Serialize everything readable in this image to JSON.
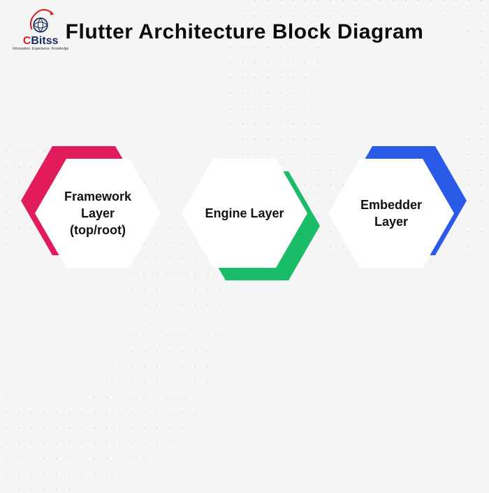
{
  "title": "Flutter Architecture Block Diagram",
  "logo": {
    "brand_prefix": "C",
    "brand_rest": "Bitss",
    "tagline": "Information. Experience. Knowledge"
  },
  "hexagons": [
    {
      "label": "Framework Layer (top/root)",
      "accent_color": "#e21b5a",
      "accent_position": "top-left"
    },
    {
      "label": "Engine Layer",
      "accent_color": "#1abc67",
      "accent_position": "bottom-right"
    },
    {
      "label": "Embedder Layer",
      "accent_color": "#2a5ae8",
      "accent_position": "top-right"
    }
  ]
}
